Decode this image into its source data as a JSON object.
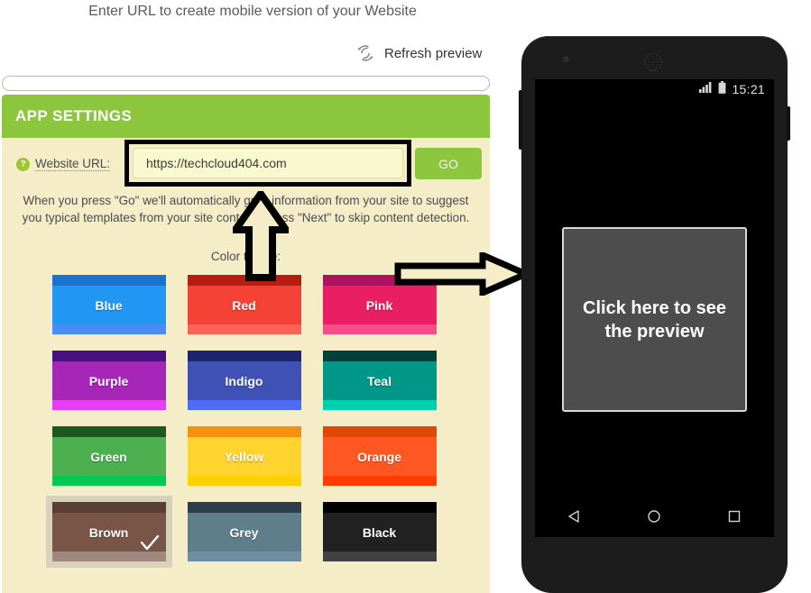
{
  "page": {
    "heading": "Enter URL to create mobile version of your Website"
  },
  "refresh": {
    "label": "Refresh preview",
    "icon": "refresh-icon"
  },
  "top_url_bar": {
    "value": "",
    "placeholder": ""
  },
  "settings": {
    "header_title": "APP SETTINGS",
    "help_icon_label": "?",
    "url_label": "Website URL:",
    "url_value": "https://techcloud404.com",
    "url_placeholder": "",
    "go_label": "GO",
    "description": "When you press \"Go\" we'll automatically grab information from your site to suggest you typical templates from your site content. Press \"Next\" to skip content detection.",
    "color_theme_label": "Color theme:",
    "header_color": "#8cc63e",
    "card_background": "#f5ecc8",
    "swatches": [
      {
        "name": "Blue",
        "top": "#1a73cc",
        "mid": "#2196f3",
        "bottom": "#4a8cf7",
        "selected": false
      },
      {
        "name": "Red",
        "top": "#b71c10",
        "mid": "#f44336",
        "bottom": "#fc6355",
        "selected": false
      },
      {
        "name": "Pink",
        "top": "#ad125e",
        "mid": "#e91e63",
        "bottom": "#fb4c8a",
        "selected": false
      },
      {
        "name": "Purple",
        "top": "#4a1080",
        "mid": "#a626b8",
        "bottom": "#e53ef5",
        "selected": false
      },
      {
        "name": "Indigo",
        "top": "#1d2470",
        "mid": "#3f51b5",
        "bottom": "#4f6cf7",
        "selected": false
      },
      {
        "name": "Teal",
        "top": "#00413a",
        "mid": "#009688",
        "bottom": "#00cfae",
        "selected": false
      },
      {
        "name": "Green",
        "top": "#1a5a1f",
        "mid": "#4caf50",
        "bottom": "#00c853",
        "selected": false
      },
      {
        "name": "Yellow",
        "top": "#f79010",
        "mid": "#ffd42e",
        "bottom": "#ffd000",
        "selected": false
      },
      {
        "name": "Orange",
        "top": "#e04805",
        "mid": "#ff5722",
        "bottom": "#ff3d00",
        "selected": false
      },
      {
        "name": "Brown",
        "top": "#5a3f35",
        "mid": "#795548",
        "bottom": "#a1887f",
        "selected": true
      },
      {
        "name": "Grey",
        "top": "#2d3e4b",
        "mid": "#607d8b",
        "bottom": "#708ea0",
        "selected": false
      },
      {
        "name": "Black",
        "top": "#000000",
        "mid": "#212121",
        "bottom": "#424242",
        "selected": false
      }
    ]
  },
  "annotations": {
    "arrow_up": "arrow-up-icon",
    "arrow_right": "arrow-right-icon"
  },
  "phone": {
    "status_clock": "15:21",
    "status_signal_icon": "signal-bars-icon",
    "status_battery_icon": "battery-icon",
    "preview_text_line1": "Click here to see",
    "preview_text_line2": "the preview",
    "nav": {
      "back": "back-triangle-icon",
      "home": "home-circle-icon",
      "recents": "recents-square-icon"
    }
  }
}
